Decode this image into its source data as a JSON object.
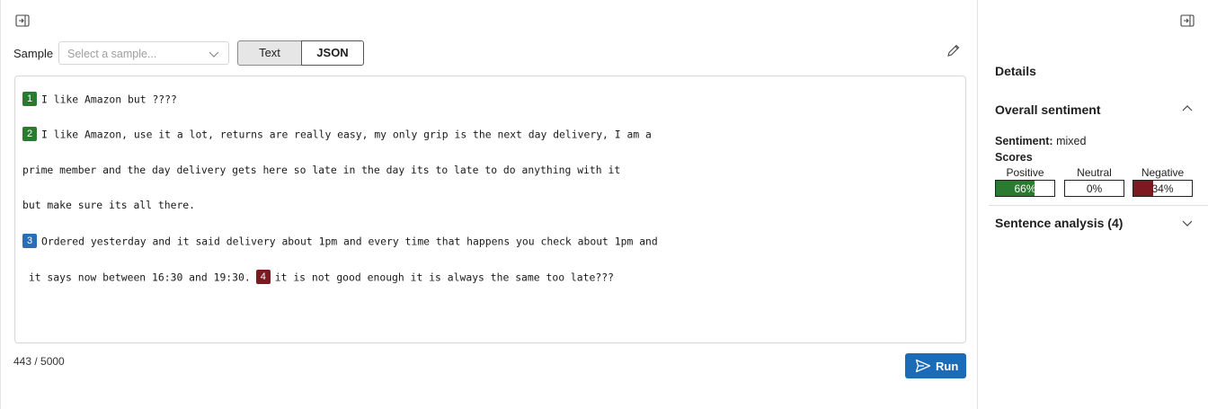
{
  "toolbar": {
    "sample_label": "Sample",
    "sample_placeholder": "Select a sample...",
    "text_tab": "Text",
    "json_tab": "JSON"
  },
  "editor": {
    "line1": {
      "badge": "1",
      "text": "I like Amazon but ????"
    },
    "line2": {
      "badge": "2",
      "text": "I like Amazon, use it a lot, returns are really easy, my only grip is the next day delivery, I am a"
    },
    "line3": "prime member and the day delivery gets here so late in the day its to late to do anything with it",
    "line4": "but make sure its all there.",
    "line5": {
      "badge": "3",
      "text": "Ordered yesterday and it said delivery about 1pm and every time that happens you check about 1pm and"
    },
    "line6": {
      "text": " it says now between 16:30 and 19:30.",
      "badge": "4",
      "text2": "it is not good enough it is always the same too late???"
    }
  },
  "footer": {
    "counter": "443 / 5000",
    "run_label": "Run"
  },
  "details": {
    "title": "Details",
    "overall_title": "Overall sentiment",
    "sentiment_key": "Sentiment:",
    "sentiment_value": "mixed",
    "scores_title": "Scores",
    "scores": [
      {
        "label": "Positive",
        "value": "66%",
        "fraction": 0.66,
        "color": "#2a7a2f"
      },
      {
        "label": "Neutral",
        "value": "0%",
        "fraction": 0.0,
        "color": "#888888"
      },
      {
        "label": "Negative",
        "value": "34%",
        "fraction": 0.34,
        "color": "#7c1a22"
      }
    ],
    "sentence_analysis": "Sentence analysis (4)"
  },
  "colors": {
    "positive": "#2a7a2f",
    "neutral_sentence": "#2a6fb5",
    "negative": "#7c1a22",
    "run_button": "#1b6bb6"
  }
}
